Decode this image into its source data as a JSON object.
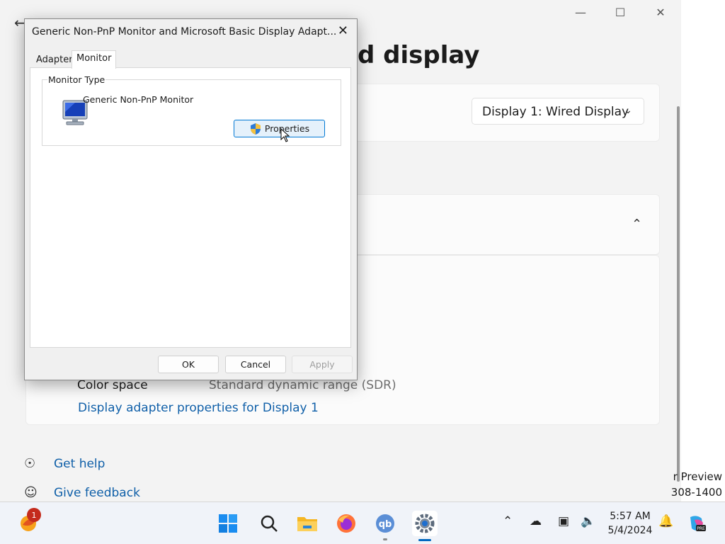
{
  "settings": {
    "heading": "d display",
    "display_select": "Display 1: Wired Display",
    "color_space_label": "Color space",
    "color_space_value": "Standard dynamic range (SDR)",
    "adapter_link": "Display adapter properties for Display 1",
    "get_help": "Get help",
    "give_feedback": "Give feedback",
    "window_controls": {
      "minimize": "—",
      "maximize": "☐",
      "close": "✕"
    }
  },
  "watermark": {
    "line1": "r Preview",
    "line2": "308-1400"
  },
  "dialog": {
    "title": "Generic Non-PnP Monitor and Microsoft Basic Display Adapt...",
    "tabs": [
      {
        "label": "Adapter",
        "active": false
      },
      {
        "label": "Monitor",
        "active": true
      }
    ],
    "group_label": "Monitor Type",
    "monitor_name": "Generic Non-PnP Monitor",
    "properties_button": "Properties",
    "ok": "OK",
    "cancel": "Cancel",
    "apply": "Apply"
  },
  "taskbar": {
    "notification_count": "1",
    "time": "5:57 AM",
    "date": "5/4/2024",
    "apps": [
      "start-icon",
      "search-icon",
      "file-explorer-icon",
      "firefox-icon",
      "qbittorrent-icon",
      "settings-icon"
    ],
    "accent": "#0067c0"
  }
}
